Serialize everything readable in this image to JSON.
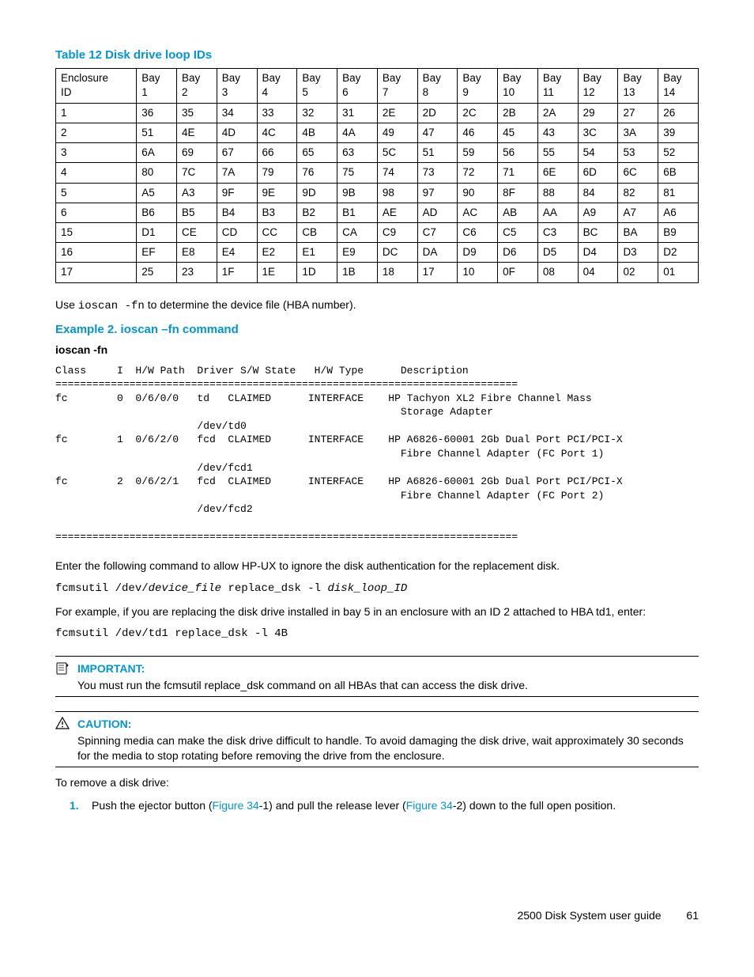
{
  "table12": {
    "title": "Table 12 Disk drive loop IDs",
    "headers": [
      "Enclosure ID",
      "Bay 1",
      "Bay 2",
      "Bay 3",
      "Bay 4",
      "Bay 5",
      "Bay 6",
      "Bay 7",
      "Bay 8",
      "Bay 9",
      "Bay 10",
      "Bay 11",
      "Bay 12",
      "Bay 13",
      "Bay 14"
    ],
    "rows": [
      [
        "1",
        "36",
        "35",
        "34",
        "33",
        "32",
        "31",
        "2E",
        "2D",
        "2C",
        "2B",
        "2A",
        "29",
        "27",
        "26"
      ],
      [
        "2",
        "51",
        "4E",
        "4D",
        "4C",
        "4B",
        "4A",
        "49",
        "47",
        "46",
        "45",
        "43",
        "3C",
        "3A",
        "39"
      ],
      [
        "3",
        "6A",
        "69",
        "67",
        "66",
        "65",
        "63",
        "5C",
        "51",
        "59",
        "56",
        "55",
        "54",
        "53",
        "52"
      ],
      [
        "4",
        "80",
        "7C",
        "7A",
        "79",
        "76",
        "75",
        "74",
        "73",
        "72",
        "71",
        "6E",
        "6D",
        "6C",
        "6B"
      ],
      [
        "5",
        "A5",
        "A3",
        "9F",
        "9E",
        "9D",
        "9B",
        "98",
        "97",
        "90",
        "8F",
        "88",
        "84",
        "82",
        "81"
      ],
      [
        "6",
        "B6",
        "B5",
        "B4",
        "B3",
        "B2",
        "B1",
        "AE",
        "AD",
        "AC",
        "AB",
        "AA",
        "A9",
        "A7",
        "A6"
      ],
      [
        "15",
        "D1",
        "CE",
        "CD",
        "CC",
        "CB",
        "CA",
        "C9",
        "C7",
        "C6",
        "C5",
        "C3",
        "BC",
        "BA",
        "B9"
      ],
      [
        "16",
        "EF",
        "E8",
        "E4",
        "E2",
        "E1",
        "E9",
        "DC",
        "DA",
        "D9",
        "D6",
        "D5",
        "D4",
        "D3",
        "D2"
      ],
      [
        "17",
        "25",
        "23",
        "1F",
        "1E",
        "1D",
        "1B",
        "18",
        "17",
        "10",
        "0F",
        "08",
        "04",
        "02",
        "01"
      ]
    ]
  },
  "para_use_ioscan_pre": "Use ",
  "para_use_ioscan_cmd": "ioscan -fn",
  "para_use_ioscan_post": " to determine the device file (HBA number).",
  "example2_title": "Example 2. ioscan –fn command",
  "ioscan_label": "ioscan -fn",
  "ioscan_output": "Class     I  H/W Path  Driver S/W State   H/W Type      Description\n===========================================================================\nfc        0  0/6/0/0   td   CLAIMED      INTERFACE    HP Tachyon XL2 Fibre Channel Mass\n                                                        Storage Adapter\n                       /dev/td0\nfc        1  0/6/2/0   fcd  CLAIMED      INTERFACE    HP A6826-60001 2Gb Dual Port PCI/PCI-X\n                                                        Fibre Channel Adapter (FC Port 1)\n                       /dev/fcd1\nfc        2  0/6/2/1   fcd  CLAIMED      INTERFACE    HP A6826-60001 2Gb Dual Port PCI/PCI-X\n                                                        Fibre Channel Adapter (FC Port 2)\n                       /dev/fcd2\n\n===========================================================================",
  "para_enter_cmd": "Enter the following command to allow HP-UX to ignore the disk authentication for the replacement disk.",
  "fcmsutil_generic_pre": "fcmsutil /dev/",
  "fcmsutil_generic_arg1": "device_file",
  "fcmsutil_generic_mid": " replace_dsk -l ",
  "fcmsutil_generic_arg2": "disk_loop_ID",
  "para_example_intro": "For example, if you are replacing the disk drive installed in bay 5 in an enclosure with an ID 2 attached to HBA td1, enter:",
  "fcmsutil_example": "fcmsutil /dev/td1 replace_dsk -l 4B",
  "important_title": "IMPORTANT:",
  "important_text": "You must run the fcmsutil replace_dsk command on all HBAs that can access the disk drive.",
  "caution_title": "CAUTION:",
  "caution_text": "Spinning media can make the disk drive difficult to handle. To avoid damaging the disk drive, wait approximately 30 seconds for the media to stop rotating before removing the drive from the enclosure.",
  "para_remove": "To remove a disk drive:",
  "step1_num": "1.",
  "step1_pre": "Push the ejector button (",
  "step1_link1": "Figure 34",
  "step1_mid1": "-1) and pull the release lever (",
  "step1_link2": "Figure 34",
  "step1_mid2": "-2) down to the full open position.",
  "footer_title": "2500 Disk System user guide",
  "footer_page": "61"
}
